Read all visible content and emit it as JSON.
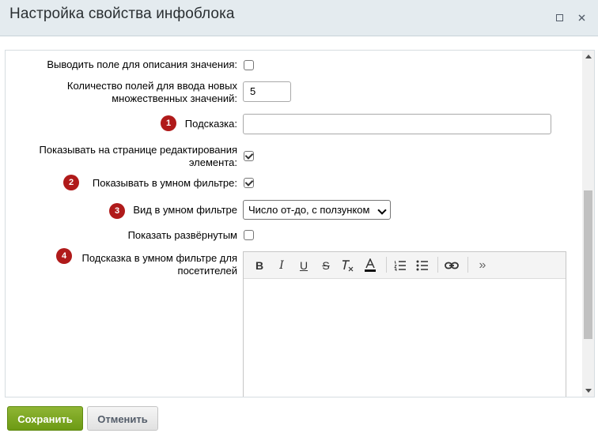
{
  "dialog": {
    "title": "Настройка свойства инфоблока",
    "maximize_icon": "maximize-icon",
    "close_icon": "close-icon"
  },
  "form": {
    "show_description_label": "Выводить поле для описания значения:",
    "show_description_checked": false,
    "multi_count_label_line1": "Количество полей для ввода новых",
    "multi_count_label_line2": "множественных значений:",
    "multi_count_value": "5",
    "hint_badge": "1",
    "hint_label": "Подсказка:",
    "hint_value": "",
    "show_on_edit_label_line1": "Показывать на странице редактирования",
    "show_on_edit_label_line2": "элемента:",
    "show_on_edit_checked": true,
    "smart_filter_badge": "2",
    "smart_filter_label": "Показывать в умном фильтре:",
    "smart_filter_checked": true,
    "filter_view_badge": "3",
    "filter_view_label": "Вид в умном фильтре",
    "filter_view_selected": "Число от-до, с ползунком",
    "expanded_label": "Показать развёрнутым",
    "expanded_checked": false,
    "filter_hint_badge": "4",
    "filter_hint_label_line1": "Подсказка в умном фильтре для",
    "filter_hint_label_line2": "посетителей"
  },
  "editor_toolbar": {
    "bold": "B",
    "italic": "I",
    "underline": "U",
    "strike": "S",
    "more": "»"
  },
  "footer": {
    "save_label": "Сохранить",
    "cancel_label": "Отменить"
  },
  "colors": {
    "header_bg": "#e4ebef",
    "badge": "#b01a1a",
    "save_button": "#7ba424"
  }
}
